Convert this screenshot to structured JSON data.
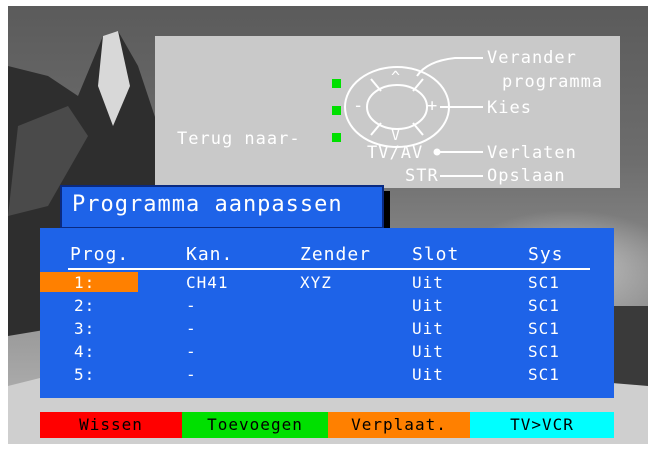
{
  "help": {
    "change_line1": "Verander",
    "change_line2": "programma",
    "select": "Kies",
    "back_to": "Terug naar-",
    "tvav": "TV/AV",
    "exit": "Verlaten",
    "str": "STR",
    "store": "Opslaan",
    "up_arrow": "^",
    "down_arrow": "V",
    "minus": "-",
    "plus": "+"
  },
  "title": "Programma aanpassen",
  "table": {
    "headers": [
      "Prog.",
      "Kan.",
      "Zender",
      "Slot",
      "Sys"
    ],
    "rows": [
      [
        "1:",
        "CH41",
        "XYZ",
        "Uit",
        "SC1"
      ],
      [
        "2:",
        "-",
        "",
        "Uit",
        "SC1"
      ],
      [
        "3:",
        "-",
        "",
        "Uit",
        "SC1"
      ],
      [
        "4:",
        "-",
        "",
        "Uit",
        "SC1"
      ],
      [
        "5:",
        "-",
        "",
        "Uit",
        "SC1"
      ]
    ]
  },
  "buttons": [
    {
      "label": "Wissen",
      "bg": "#ff0000",
      "fg": "#000000"
    },
    {
      "label": "Toevoegen",
      "bg": "#00e000",
      "fg": "#000000"
    },
    {
      "label": "Verplaat.",
      "bg": "#ff8000",
      "fg": "#000000"
    },
    {
      "label": "TV>VCR",
      "bg": "#00ffff",
      "fg": "#000000"
    }
  ],
  "colors": {
    "panel_blue": "#1e63e8",
    "selection_orange": "#ff8000",
    "help_gray": "#c9c9c9"
  }
}
